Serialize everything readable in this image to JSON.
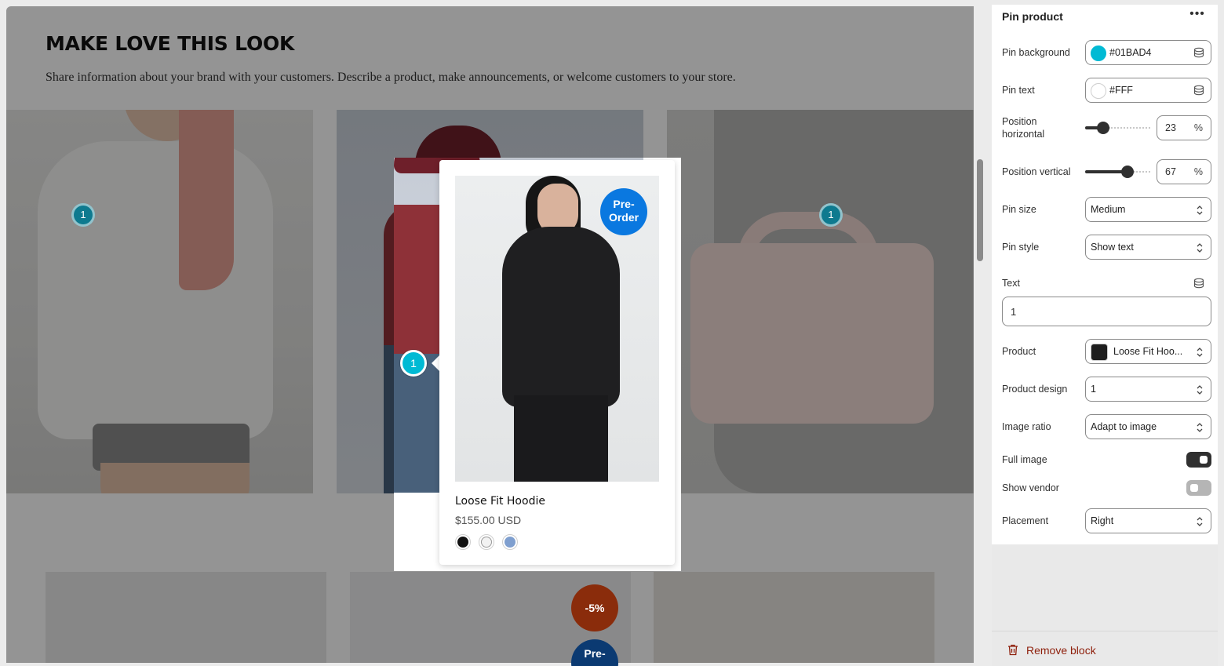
{
  "section": {
    "title": "MAKE LOVE THIS LOOK",
    "description": "Share information about your brand with your customers. Describe a product, make announcements, or welcome customers to your store."
  },
  "pins": {
    "label": "1"
  },
  "badges": {
    "sale": "-5%",
    "preorder_line1": "Pre-",
    "preorder_line2": "Order",
    "preorder_partial": "Pre-"
  },
  "popup": {
    "product_name": "Loose Fit Hoodie",
    "price": "$155.00 USD",
    "badge_line1": "Pre-",
    "badge_line2": "Order",
    "swatches": [
      "black",
      "white",
      "blue"
    ]
  },
  "panel": {
    "title": "Pin product",
    "more_icon": "more-horizontal-icon",
    "pin_background": {
      "label": "Pin background",
      "value": "#01BAD4"
    },
    "pin_text": {
      "label": "Pin text",
      "value": "#FFF"
    },
    "position_horizontal": {
      "label_line1": "Position",
      "label_line2": "horizontal",
      "value": "23",
      "unit": "%"
    },
    "position_vertical": {
      "label": "Position vertical",
      "value": "67",
      "unit": "%"
    },
    "pin_size": {
      "label": "Pin size",
      "value": "Medium"
    },
    "pin_style": {
      "label": "Pin style",
      "value": "Show text"
    },
    "text": {
      "label": "Text",
      "value": "1"
    },
    "product": {
      "label": "Product",
      "value": "Loose Fit Hoo..."
    },
    "product_design": {
      "label": "Product design",
      "value": "1"
    },
    "image_ratio": {
      "label": "Image ratio",
      "value": "Adapt to image"
    },
    "full_image": {
      "label": "Full image",
      "on": true
    },
    "show_vendor": {
      "label": "Show vendor",
      "on": false
    },
    "placement": {
      "label": "Placement",
      "value": "Right"
    },
    "remove_label": "Remove block"
  },
  "colors": {
    "pin": "#01BAD4",
    "preorder": "#0A78E0",
    "sale": "#E44D14",
    "danger": "#8E1F0B"
  }
}
